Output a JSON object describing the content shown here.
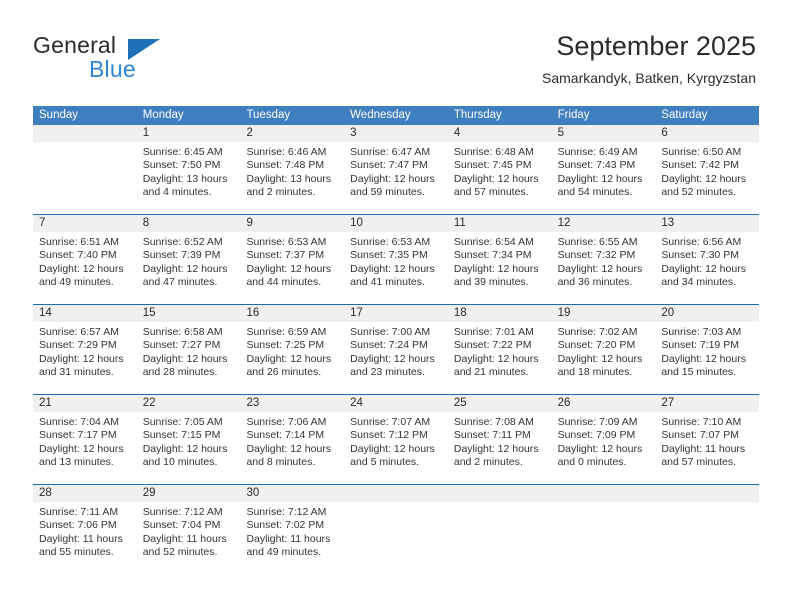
{
  "brand": {
    "name_top": "General",
    "name_bottom": "Blue",
    "triangle_color": "#1e70b8",
    "blue_text_color": "#2e86d4"
  },
  "header": {
    "title": "September 2025",
    "subtitle": "Samarkandyk, Batken, Kyrgyzstan"
  },
  "theme": {
    "header_row_bg": "#3f7fbf",
    "week_divider": "#1f6bb0",
    "day_number_bg": "#f0f0f0",
    "text": "#2b2b2b"
  },
  "weekday_headers": [
    "Sunday",
    "Monday",
    "Tuesday",
    "Wednesday",
    "Thursday",
    "Friday",
    "Saturday"
  ],
  "labels": {
    "sunrise": "Sunrise:",
    "sunset": "Sunset:",
    "daylight": "Daylight:"
  },
  "weeks": [
    {
      "numbers": [
        "",
        "1",
        "2",
        "3",
        "4",
        "5",
        "6"
      ],
      "cells": [
        {
          "empty": true,
          "lines": []
        },
        {
          "empty": false,
          "lines": [
            "Sunrise: 6:45 AM",
            "Sunset: 7:50 PM",
            "Daylight: 13 hours",
            "and 4 minutes."
          ]
        },
        {
          "empty": false,
          "lines": [
            "Sunrise: 6:46 AM",
            "Sunset: 7:48 PM",
            "Daylight: 13 hours",
            "and 2 minutes."
          ]
        },
        {
          "empty": false,
          "lines": [
            "Sunrise: 6:47 AM",
            "Sunset: 7:47 PM",
            "Daylight: 12 hours",
            "and 59 minutes."
          ]
        },
        {
          "empty": false,
          "lines": [
            "Sunrise: 6:48 AM",
            "Sunset: 7:45 PM",
            "Daylight: 12 hours",
            "and 57 minutes."
          ]
        },
        {
          "empty": false,
          "lines": [
            "Sunrise: 6:49 AM",
            "Sunset: 7:43 PM",
            "Daylight: 12 hours",
            "and 54 minutes."
          ]
        },
        {
          "empty": false,
          "lines": [
            "Sunrise: 6:50 AM",
            "Sunset: 7:42 PM",
            "Daylight: 12 hours",
            "and 52 minutes."
          ]
        }
      ]
    },
    {
      "numbers": [
        "7",
        "8",
        "9",
        "10",
        "11",
        "12",
        "13"
      ],
      "cells": [
        {
          "empty": false,
          "lines": [
            "Sunrise: 6:51 AM",
            "Sunset: 7:40 PM",
            "Daylight: 12 hours",
            "and 49 minutes."
          ]
        },
        {
          "empty": false,
          "lines": [
            "Sunrise: 6:52 AM",
            "Sunset: 7:39 PM",
            "Daylight: 12 hours",
            "and 47 minutes."
          ]
        },
        {
          "empty": false,
          "lines": [
            "Sunrise: 6:53 AM",
            "Sunset: 7:37 PM",
            "Daylight: 12 hours",
            "and 44 minutes."
          ]
        },
        {
          "empty": false,
          "lines": [
            "Sunrise: 6:53 AM",
            "Sunset: 7:35 PM",
            "Daylight: 12 hours",
            "and 41 minutes."
          ]
        },
        {
          "empty": false,
          "lines": [
            "Sunrise: 6:54 AM",
            "Sunset: 7:34 PM",
            "Daylight: 12 hours",
            "and 39 minutes."
          ]
        },
        {
          "empty": false,
          "lines": [
            "Sunrise: 6:55 AM",
            "Sunset: 7:32 PM",
            "Daylight: 12 hours",
            "and 36 minutes."
          ]
        },
        {
          "empty": false,
          "lines": [
            "Sunrise: 6:56 AM",
            "Sunset: 7:30 PM",
            "Daylight: 12 hours",
            "and 34 minutes."
          ]
        }
      ]
    },
    {
      "numbers": [
        "14",
        "15",
        "16",
        "17",
        "18",
        "19",
        "20"
      ],
      "cells": [
        {
          "empty": false,
          "lines": [
            "Sunrise: 6:57 AM",
            "Sunset: 7:29 PM",
            "Daylight: 12 hours",
            "and 31 minutes."
          ]
        },
        {
          "empty": false,
          "lines": [
            "Sunrise: 6:58 AM",
            "Sunset: 7:27 PM",
            "Daylight: 12 hours",
            "and 28 minutes."
          ]
        },
        {
          "empty": false,
          "lines": [
            "Sunrise: 6:59 AM",
            "Sunset: 7:25 PM",
            "Daylight: 12 hours",
            "and 26 minutes."
          ]
        },
        {
          "empty": false,
          "lines": [
            "Sunrise: 7:00 AM",
            "Sunset: 7:24 PM",
            "Daylight: 12 hours",
            "and 23 minutes."
          ]
        },
        {
          "empty": false,
          "lines": [
            "Sunrise: 7:01 AM",
            "Sunset: 7:22 PM",
            "Daylight: 12 hours",
            "and 21 minutes."
          ]
        },
        {
          "empty": false,
          "lines": [
            "Sunrise: 7:02 AM",
            "Sunset: 7:20 PM",
            "Daylight: 12 hours",
            "and 18 minutes."
          ]
        },
        {
          "empty": false,
          "lines": [
            "Sunrise: 7:03 AM",
            "Sunset: 7:19 PM",
            "Daylight: 12 hours",
            "and 15 minutes."
          ]
        }
      ]
    },
    {
      "numbers": [
        "21",
        "22",
        "23",
        "24",
        "25",
        "26",
        "27"
      ],
      "cells": [
        {
          "empty": false,
          "lines": [
            "Sunrise: 7:04 AM",
            "Sunset: 7:17 PM",
            "Daylight: 12 hours",
            "and 13 minutes."
          ]
        },
        {
          "empty": false,
          "lines": [
            "Sunrise: 7:05 AM",
            "Sunset: 7:15 PM",
            "Daylight: 12 hours",
            "and 10 minutes."
          ]
        },
        {
          "empty": false,
          "lines": [
            "Sunrise: 7:06 AM",
            "Sunset: 7:14 PM",
            "Daylight: 12 hours",
            "and 8 minutes."
          ]
        },
        {
          "empty": false,
          "lines": [
            "Sunrise: 7:07 AM",
            "Sunset: 7:12 PM",
            "Daylight: 12 hours",
            "and 5 minutes."
          ]
        },
        {
          "empty": false,
          "lines": [
            "Sunrise: 7:08 AM",
            "Sunset: 7:11 PM",
            "Daylight: 12 hours",
            "and 2 minutes."
          ]
        },
        {
          "empty": false,
          "lines": [
            "Sunrise: 7:09 AM",
            "Sunset: 7:09 PM",
            "Daylight: 12 hours",
            "and 0 minutes."
          ]
        },
        {
          "empty": false,
          "lines": [
            "Sunrise: 7:10 AM",
            "Sunset: 7:07 PM",
            "Daylight: 11 hours",
            "and 57 minutes."
          ]
        }
      ]
    },
    {
      "numbers": [
        "28",
        "29",
        "30",
        "",
        "",
        "",
        ""
      ],
      "cells": [
        {
          "empty": false,
          "lines": [
            "Sunrise: 7:11 AM",
            "Sunset: 7:06 PM",
            "Daylight: 11 hours",
            "and 55 minutes."
          ]
        },
        {
          "empty": false,
          "lines": [
            "Sunrise: 7:12 AM",
            "Sunset: 7:04 PM",
            "Daylight: 11 hours",
            "and 52 minutes."
          ]
        },
        {
          "empty": false,
          "lines": [
            "Sunrise: 7:12 AM",
            "Sunset: 7:02 PM",
            "Daylight: 11 hours",
            "and 49 minutes."
          ]
        },
        {
          "empty": true,
          "lines": []
        },
        {
          "empty": true,
          "lines": []
        },
        {
          "empty": true,
          "lines": []
        },
        {
          "empty": true,
          "lines": []
        }
      ]
    }
  ]
}
